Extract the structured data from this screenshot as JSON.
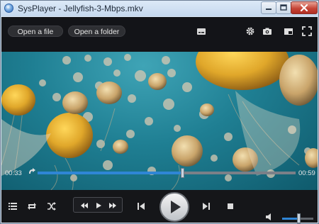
{
  "window": {
    "title": "SysPlayer - Jellyfish-3-Mbps.mkv"
  },
  "toolbar": {
    "open_file_label": "Open a file",
    "open_folder_label": "Open a folder",
    "icons": [
      "subtitles-icon",
      "gear-icon",
      "camera-icon",
      "miniplayer-icon",
      "fullscreen-icon"
    ]
  },
  "seek": {
    "elapsed": "00:33",
    "duration": "00:59",
    "progress_percent": 56
  },
  "controls": {
    "icons": [
      "playlist-icon",
      "repeat-icon",
      "shuffle-icon",
      "rewind-icon",
      "play-small-icon",
      "fast-forward-icon",
      "previous-icon",
      "play-icon",
      "next-icon",
      "stop-icon",
      "volume-icon"
    ]
  },
  "volume": {
    "level_percent": 52
  },
  "colors": {
    "accent": "#2f86d6",
    "video_water": "#1f7f93",
    "jellyfish": "#e0a72a"
  }
}
